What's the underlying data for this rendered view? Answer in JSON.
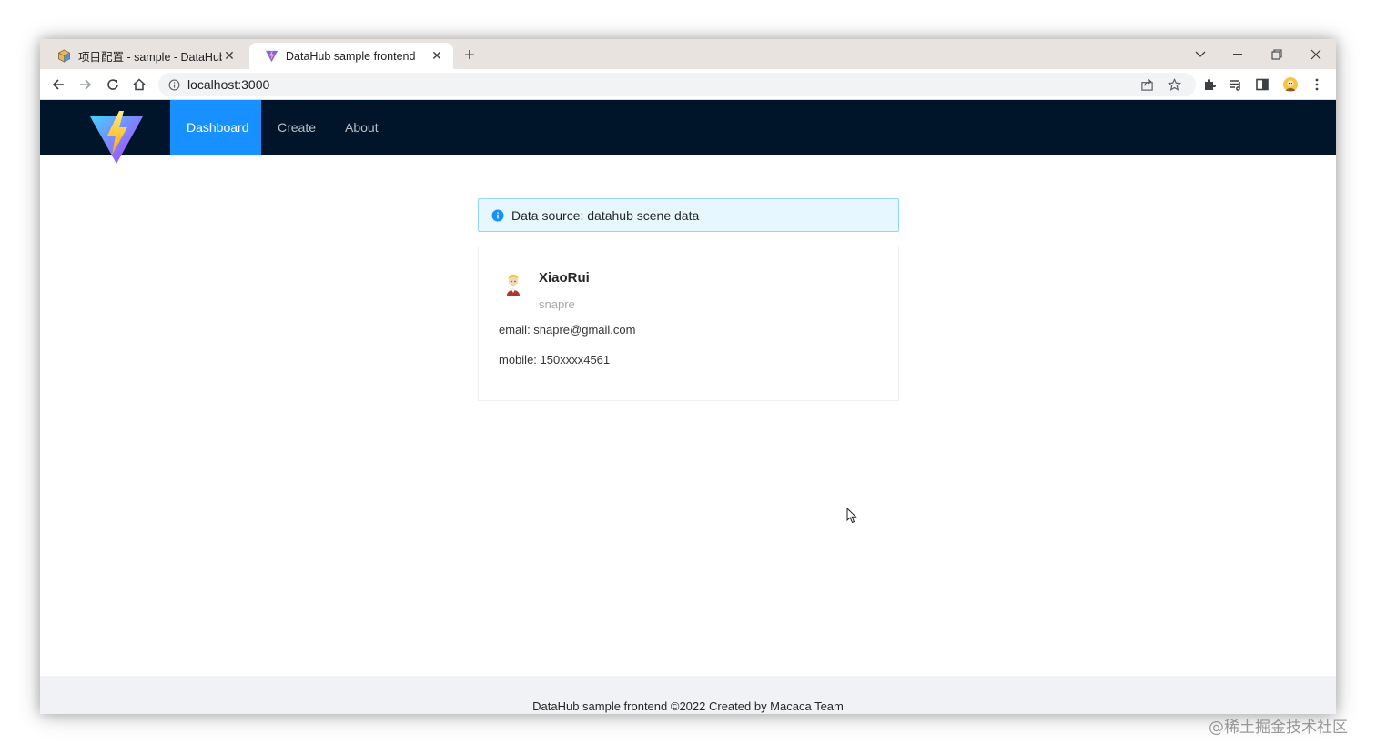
{
  "browser": {
    "tabs": [
      {
        "title": "项目配置 - sample - DataHub",
        "active": false,
        "icon": "cube-icon"
      },
      {
        "title": "DataHub sample frontend",
        "active": true,
        "icon": "vite-icon"
      }
    ],
    "new_tab_label": "+",
    "address": "localhost:3000",
    "toolbar_icons": [
      "back-icon",
      "forward-icon",
      "reload-icon",
      "home-icon",
      "share-icon",
      "star-icon",
      "extensions-icon",
      "reading-list-icon",
      "side-panel-icon",
      "profile-icon",
      "menu-icon"
    ]
  },
  "app": {
    "nav": [
      "Dashboard",
      "Create",
      "About"
    ],
    "selected_nav": "Dashboard",
    "alert": "Data source: datahub scene data",
    "user": {
      "name": "XiaoRui",
      "username": "snapre",
      "email_line": "email: snapre@gmail.com",
      "mobile_line": "mobile: 150xxxx4561"
    },
    "footer": "DataHub sample frontend ©2022 Created by Macaca Team"
  },
  "watermark": "@稀土掘金技术社区",
  "colors": {
    "header_bg": "#001529",
    "nav_selected": "#1890ff",
    "alert_bg": "#e6f7ff",
    "alert_border": "#91d5ff",
    "footer_bg": "#f0f2f5"
  }
}
